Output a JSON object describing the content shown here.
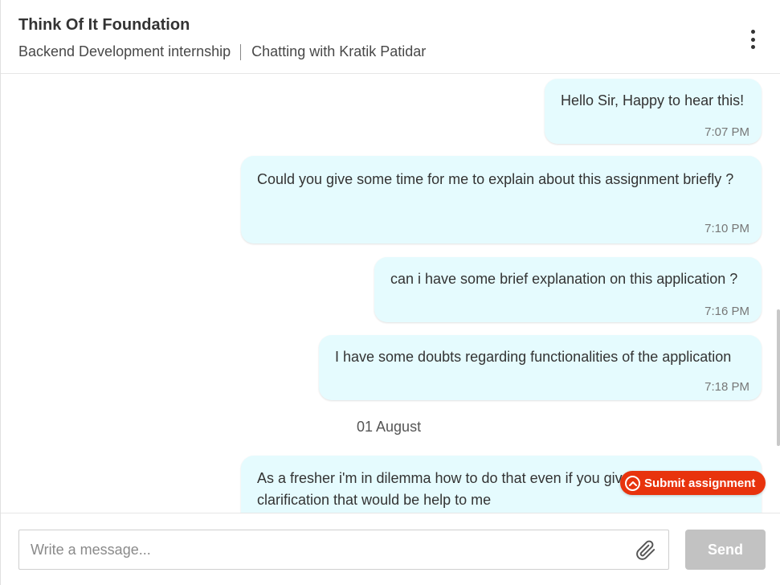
{
  "header": {
    "company": "Think Of It Foundation",
    "internship": "Backend Development internship",
    "chatting_with": "Chatting with Kratik Patidar",
    "menu_icon": "kebab-menu-icon"
  },
  "messages": [
    {
      "text": "Hello Sir, Happy to hear this!",
      "time": "7:07 PM",
      "sender": "self"
    },
    {
      "text": "Could you give some time for me to explain about this assignment briefly ?",
      "time": "7:10 PM",
      "sender": "self"
    },
    {
      "text": "can i have some brief explanation on this application ?",
      "time": "7:16 PM",
      "sender": "self"
    },
    {
      "text": "I have some doubts regarding functionalities of the application",
      "time": "7:18 PM",
      "sender": "self"
    },
    {
      "text": "As a fresher i'm in dilemma how to do that even if you give clarification that would be help to me",
      "time": "",
      "sender": "self"
    }
  ],
  "date_separator": "01 August",
  "submit_assignment": {
    "label": "Submit assignment",
    "icon": "chevron-up-circle-icon",
    "color": "#e8330d"
  },
  "composer": {
    "placeholder": "Write a message...",
    "value": "",
    "attach_icon": "paperclip-icon",
    "send_label": "Send"
  },
  "colors": {
    "bubble": "#e5fbfe",
    "send_disabled": "#c2c2c2"
  }
}
